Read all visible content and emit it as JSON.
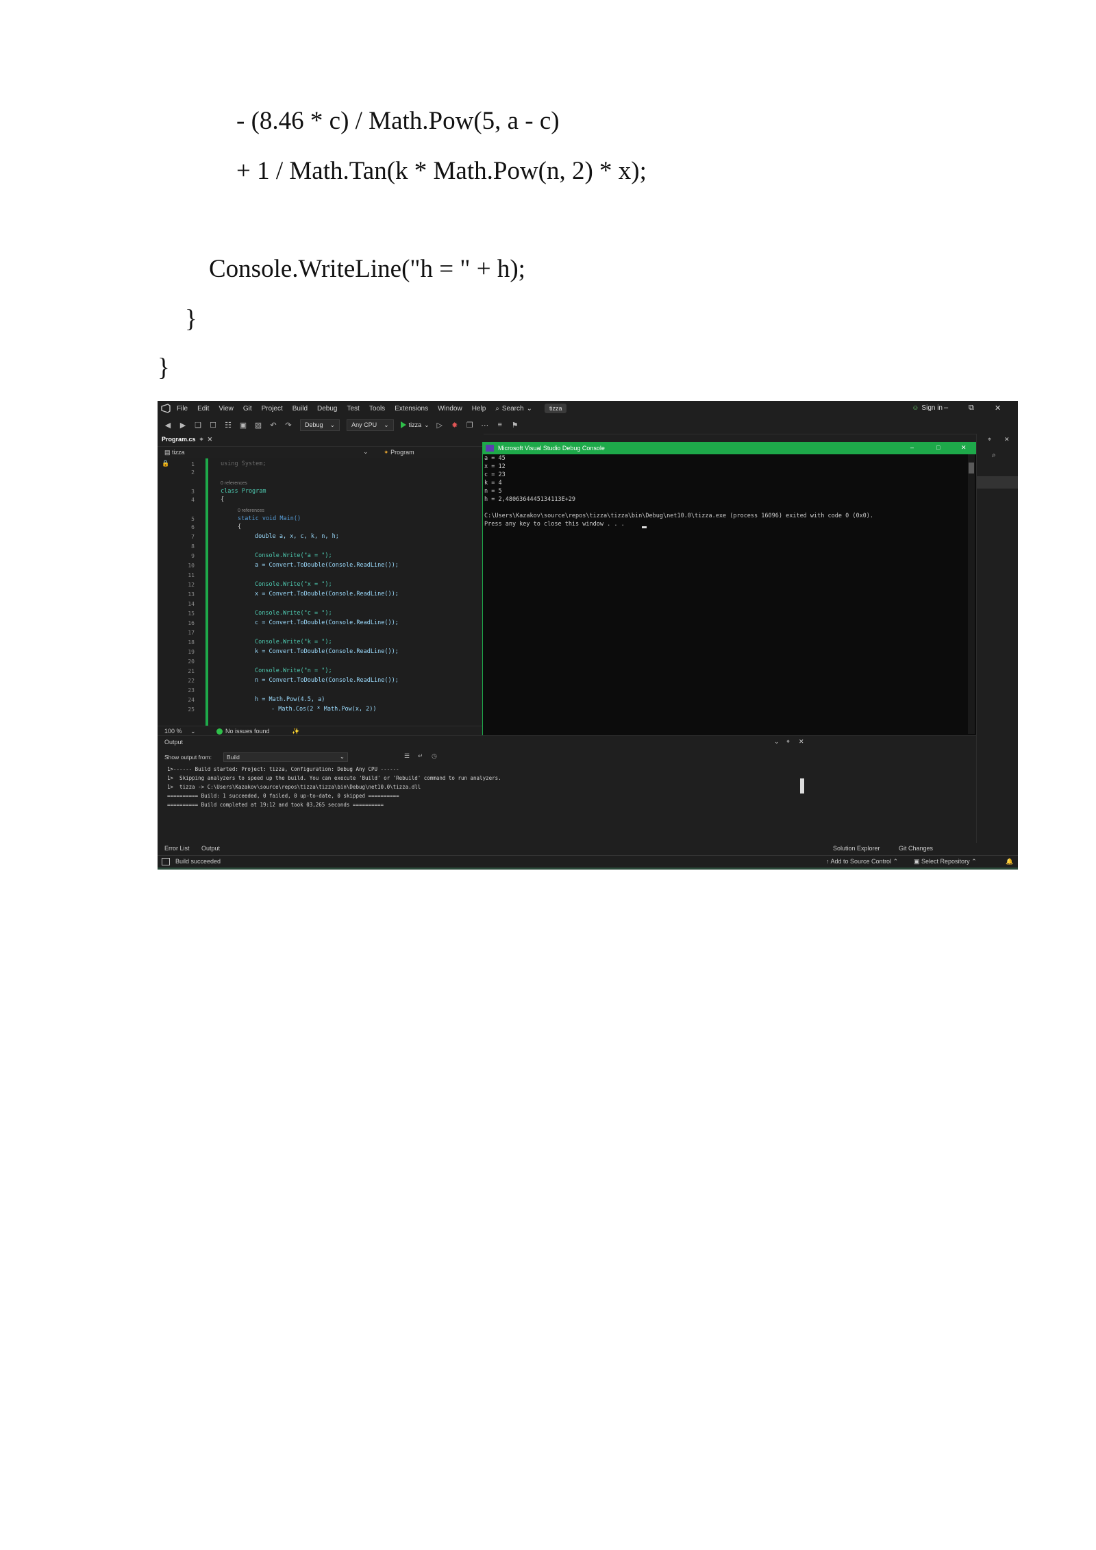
{
  "doc": {
    "lines": [
      "- (8.46 * c) / Math.Pow(5, a - c)",
      "+ 1 / Math.Tan(k * Math.Pow(n, 2) * x);",
      "Console.WriteLine(\"h = \" + h);",
      "}",
      "}"
    ]
  },
  "ide": {
    "menu": [
      "File",
      "Edit",
      "View",
      "Git",
      "Project",
      "Build",
      "Debug",
      "Test",
      "Tools",
      "Extensions",
      "Window",
      "Help"
    ],
    "search_label": "Search",
    "solution_name": "tizza",
    "signin_label": "Sign in",
    "toolbar": {
      "config": "Debug",
      "platform": "Any CPU",
      "run_target": "tizza"
    },
    "editor": {
      "tab_label": "Program.cs",
      "nav_left": "tizza",
      "nav_right": "Program",
      "line_numbers": [
        "1",
        "2",
        "3",
        "4",
        "5",
        "6",
        "7",
        "8",
        "9",
        "10",
        "11",
        "12",
        "13",
        "14",
        "15",
        "16",
        "17",
        "18",
        "19",
        "20",
        "21",
        "22",
        "23",
        "24",
        "25"
      ],
      "references_1": "0 references",
      "references_2": "0 references",
      "code": {
        "l1": "using System;",
        "l3": "class Program",
        "l4": "{",
        "l5": "static void Main()",
        "l6": "{",
        "l7": "double a, x, c, k, n, h;",
        "l9": "Console.Write(\"a = \");",
        "l10": "a = Convert.ToDouble(Console.ReadLine());",
        "l12": "Console.Write(\"x = \");",
        "l13": "x = Convert.ToDouble(Console.ReadLine());",
        "l15": "Console.Write(\"c = \");",
        "l16": "c = Convert.ToDouble(Console.ReadLine());",
        "l18": "Console.Write(\"k = \");",
        "l19": "k = Convert.ToDouble(Console.ReadLine());",
        "l21": "Console.Write(\"n = \");",
        "l22": "n = Convert.ToDouble(Console.ReadLine());",
        "l24": "h = Math.Pow(4.5, a)",
        "l25": "- Math.Cos(2 * Math.Pow(x, 2))"
      },
      "zoom": "100 %",
      "issues": "No issues found"
    },
    "console": {
      "title": "Microsoft Visual Studio Debug Console",
      "lines": [
        "a = 45",
        "x = 12",
        "c = 23",
        "k = 4",
        "n = 5",
        "h = 2,4806364445134113E+29",
        "",
        "C:\\Users\\Kazakov\\source\\repos\\tizza\\tizza\\bin\\Debug\\net10.0\\tizza.exe (process 16096) exited with code 0 (0x0).",
        "Press any key to close this window . . ."
      ]
    },
    "output": {
      "title": "Output",
      "show_from_label": "Show output from:",
      "show_from_value": "Build",
      "lines": [
        "1>------ Build started: Project: tizza, Configuration: Debug Any CPU ------",
        "1>  Skipping analyzers to speed up the build. You can execute 'Build' or 'Rebuild' command to run analyzers.",
        "1>  tizza -> C:\\Users\\Kazakov\\source\\repos\\tizza\\tizza\\bin\\Debug\\net10.0\\tizza.dll",
        "========== Build: 1 succeeded, 0 failed, 0 up-to-date, 0 skipped ==========",
        "========== Build completed at 19:12 and took 03,265 seconds =========="
      ]
    },
    "bottom_tabs": [
      "Error List",
      "Output"
    ],
    "right_tabs": [
      "Solution Explorer",
      "Git Changes"
    ],
    "status": {
      "left": "Build succeeded",
      "source_control": "Add to Source Control",
      "repo": "Select Repository"
    },
    "colors": {
      "accent_green": "#1ea94a",
      "background": "#1f1f1f"
    }
  }
}
